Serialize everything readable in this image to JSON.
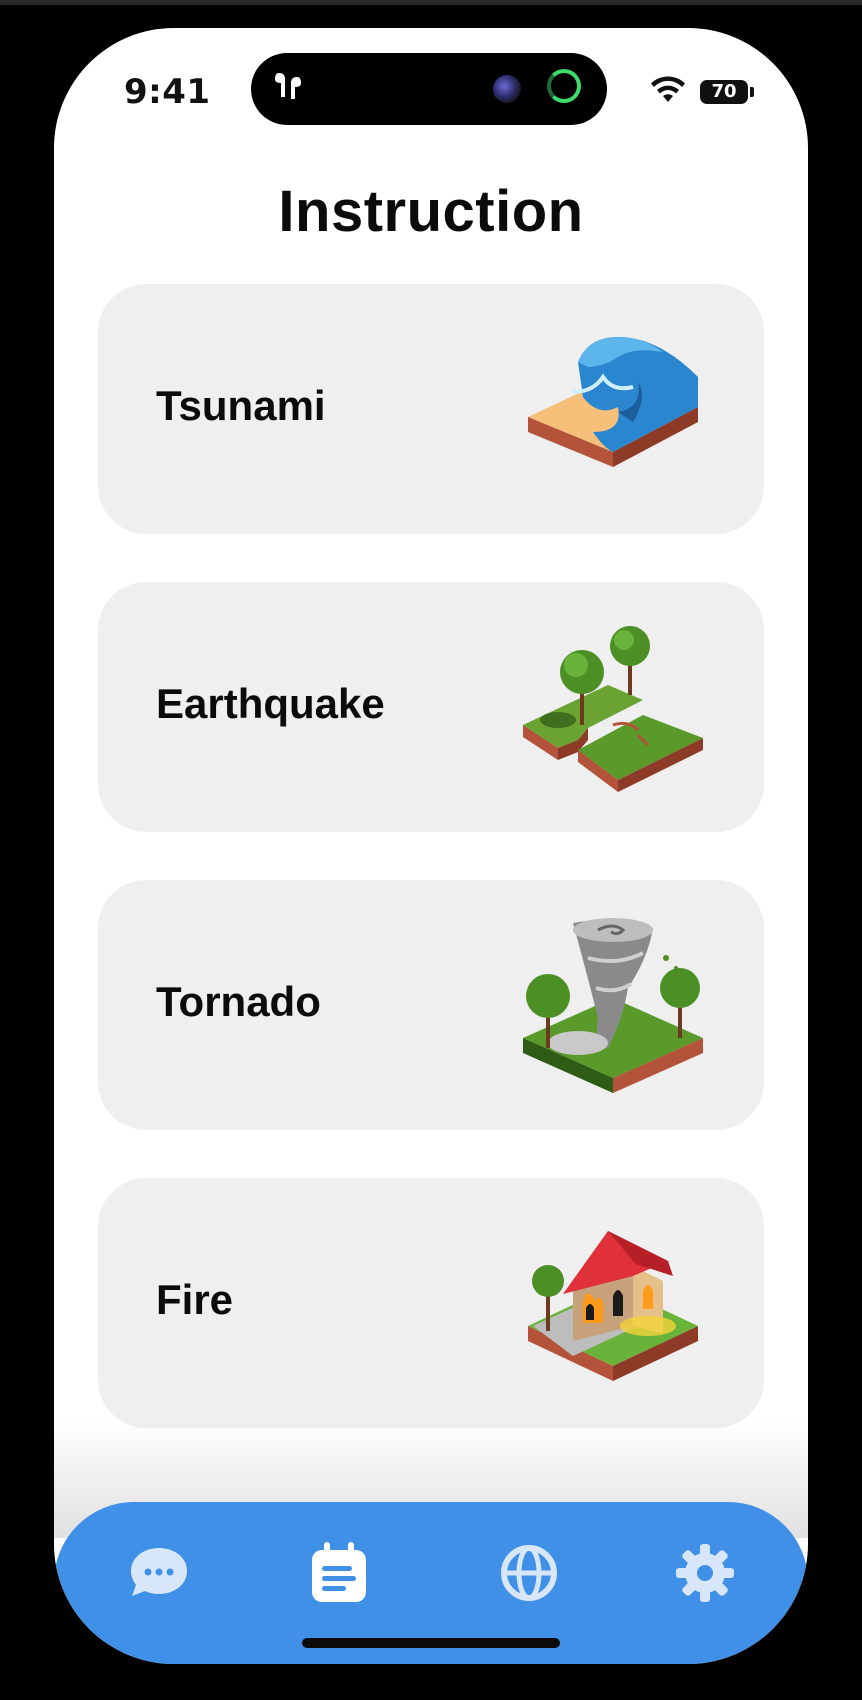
{
  "status_bar": {
    "time": "9:41",
    "battery_level": "70",
    "icons": [
      "airpods-icon",
      "camera-indicator",
      "activity-ring",
      "wifi-icon",
      "battery-icon"
    ]
  },
  "page": {
    "title": "Instruction"
  },
  "cards": [
    {
      "label": "Tsunami",
      "icon": "tsunami-illustration"
    },
    {
      "label": "Earthquake",
      "icon": "earthquake-illustration"
    },
    {
      "label": "Tornado",
      "icon": "tornado-illustration"
    },
    {
      "label": "Fire",
      "icon": "fire-illustration"
    }
  ],
  "tab_bar": {
    "active_index": 1,
    "tabs": [
      {
        "icon": "chat-icon",
        "active": false
      },
      {
        "icon": "calendar-list-icon",
        "active": true
      },
      {
        "icon": "globe-icon",
        "active": false
      },
      {
        "icon": "gear-icon",
        "active": false
      }
    ]
  },
  "colors": {
    "accent": "#4190e8",
    "card_background": "#efefef",
    "tab_icon_inactive": "#d7e6f9",
    "tab_icon_active": "#ffffff"
  }
}
